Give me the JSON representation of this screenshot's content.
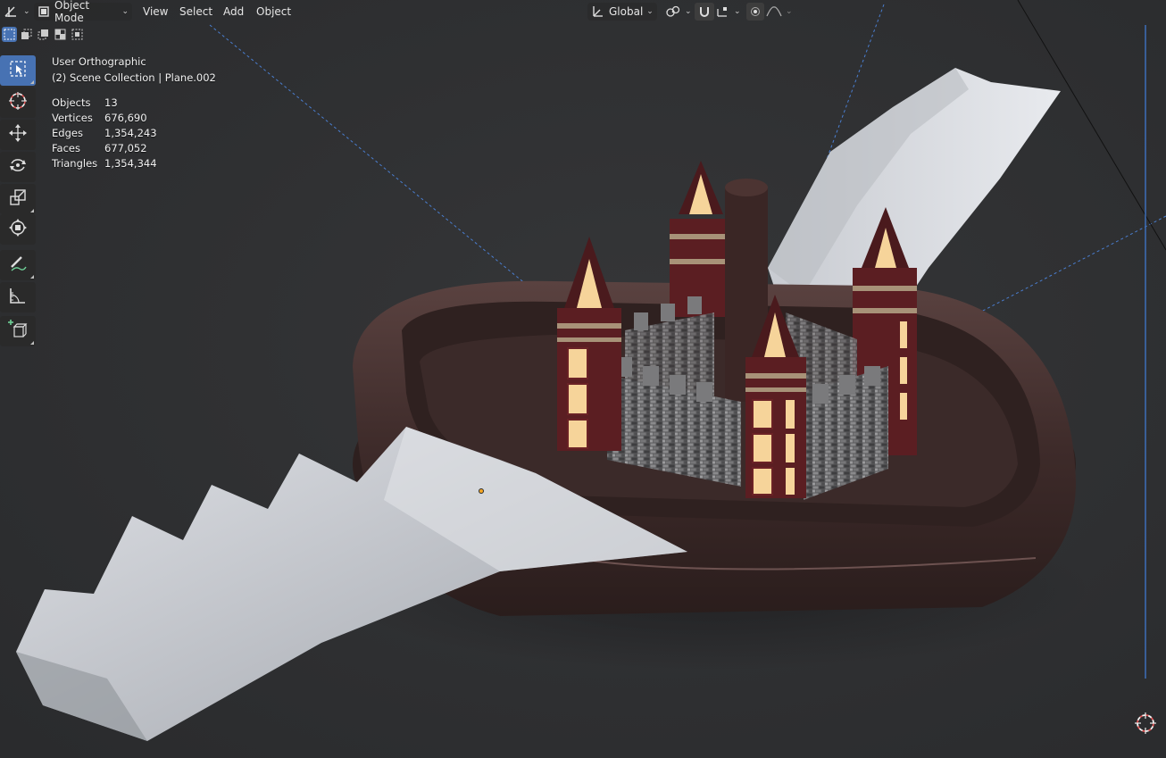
{
  "header": {
    "editor_type_icon": "editor-type-icon",
    "mode": {
      "icon": "object-mode-icon",
      "label": "Object Mode"
    },
    "menus": [
      "View",
      "Select",
      "Add",
      "Object"
    ],
    "transform_orientation": {
      "icon": "orientation-axes-icon",
      "label": "Global"
    },
    "pivot_icon": "pivot-point-icon",
    "snap_icon": "magnet-icon",
    "snap_target_icon": "snap-target-icon",
    "proportional_icon": "proportional-editing-icon",
    "falloff_icon": "falloff-curve-icon"
  },
  "selection_modes": [
    "select-new-icon",
    "select-extend-icon",
    "select-subtract-icon",
    "select-invert-icon",
    "select-intersect-icon"
  ],
  "toolbar": {
    "tools": [
      {
        "name": "select-box",
        "icon": "select-box-icon"
      },
      {
        "name": "cursor",
        "icon": "cursor-icon"
      },
      {
        "name": "move",
        "icon": "move-icon"
      },
      {
        "name": "rotate",
        "icon": "rotate-icon"
      },
      {
        "name": "scale",
        "icon": "scale-icon"
      },
      {
        "name": "transform",
        "icon": "transform-icon"
      },
      {
        "name": "annotate",
        "icon": "annotate-icon"
      },
      {
        "name": "measure",
        "icon": "measure-icon"
      },
      {
        "name": "add-cube",
        "icon": "add-cube-icon"
      }
    ],
    "active_tool": "select-box"
  },
  "overlay": {
    "view_name": "User Orthographic",
    "collection": "(2) Scene Collection | Plane.002"
  },
  "stats": [
    {
      "label": "Objects",
      "value": "13"
    },
    {
      "label": "Vertices",
      "value": "676,690"
    },
    {
      "label": "Edges",
      "value": "1,354,243"
    },
    {
      "label": "Faces",
      "value": "677,052"
    },
    {
      "label": "Triangles",
      "value": "1,354,344"
    }
  ],
  "colors": {
    "viewport_bg": "#2e2f31",
    "active_blue": "#4772b3",
    "bowl": "#4a3634",
    "brick_red": "#5e1f22",
    "window_glow": "#f6d49a",
    "wall_gray": "#6e6e6e",
    "paper": "#c9ccd1"
  },
  "nav_gizmo_icon": "3d-cursor-icon"
}
